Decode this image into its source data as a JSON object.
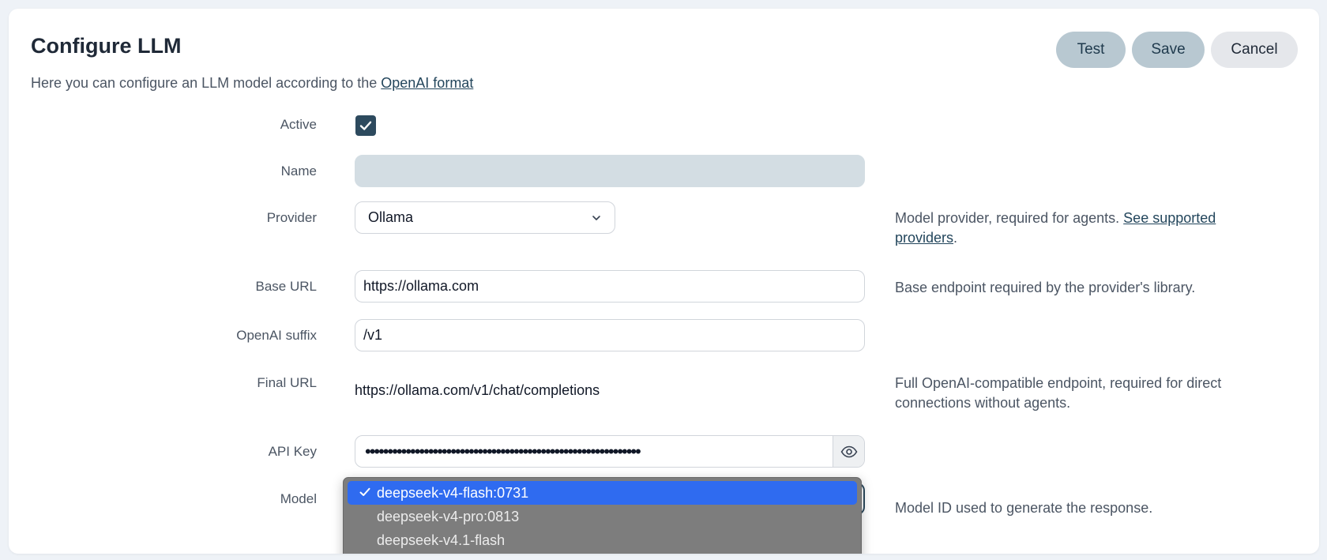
{
  "header": {
    "title": "Configure LLM",
    "subtitle_text": "Here you can configure an LLM model according to the ",
    "subtitle_link": "OpenAI format"
  },
  "toolbar": {
    "test_label": "Test",
    "save_label": "Save",
    "cancel_label": "Cancel"
  },
  "form": {
    "active": {
      "label": "Active",
      "checked": true
    },
    "name": {
      "label": "Name",
      "value": ""
    },
    "provider": {
      "label": "Provider",
      "value": "Ollama",
      "help_text": "Model provider, required for agents. ",
      "help_link": "See supported providers",
      "help_suffix": "."
    },
    "base_url": {
      "label": "Base URL",
      "value": "https://ollama.com",
      "help_text": "Base endpoint required by the provider's library."
    },
    "openai_suffix": {
      "label": "OpenAI suffix",
      "value": "/v1"
    },
    "final_url": {
      "label": "Final URL",
      "value": "https://ollama.com/v1/chat/completions",
      "help_text": "Full OpenAI-compatible endpoint, required for direct connections without agents."
    },
    "api_key": {
      "label": "API Key",
      "masked_value": "•••••••••••••••••••••••••••••••••••••••••••••••••••••••••••••"
    },
    "model": {
      "label": "Model",
      "help_text": "Model ID used to generate the response.",
      "options": [
        {
          "label": "deepseek-v4-flash:0731",
          "selected": true
        },
        {
          "label": "deepseek-v4-pro:0813",
          "selected": false
        },
        {
          "label": "deepseek-v4.1-flash",
          "selected": false
        }
      ]
    }
  },
  "colors": {
    "accent": "#2d4a5e",
    "button_secondary": "#b8c8d1",
    "selection_highlight": "#2f6bf0"
  },
  "icons": {
    "checkbox": "check-icon",
    "provider_select": "chevron-down-icon",
    "api_key_toggle": "eye-icon"
  }
}
